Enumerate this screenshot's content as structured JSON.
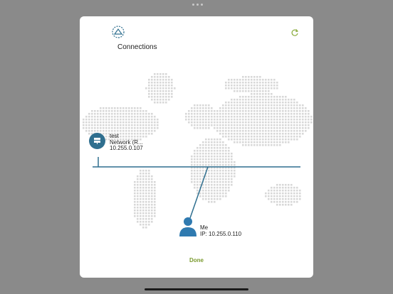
{
  "header": {
    "title": "Connections",
    "icon": "connections-icon",
    "refresh_icon": "refresh-icon"
  },
  "server": {
    "name": "test",
    "type": "Network (R...",
    "ip": "10.255.0.107",
    "icon": "server-icon"
  },
  "me": {
    "name": "Me",
    "ip": "IP: 10.255.0.110",
    "icon": "person-icon"
  },
  "footer": {
    "done_label": "Done"
  },
  "colors": {
    "accent": "#2f6f8f",
    "done": "#7a9a2e",
    "map_dot": "#d8d8d8"
  }
}
